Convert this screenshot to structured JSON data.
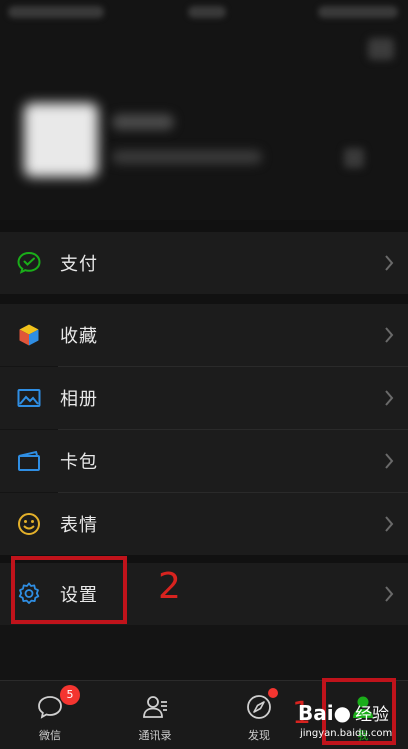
{
  "menu": {
    "pay": {
      "label": "支付",
      "icon": "wechat-pay-icon"
    },
    "favorites": {
      "label": "收藏",
      "icon": "favorites-cube-icon"
    },
    "album": {
      "label": "相册",
      "icon": "album-icon"
    },
    "cards": {
      "label": "卡包",
      "icon": "card-wallet-icon"
    },
    "stickers": {
      "label": "表情",
      "icon": "sticker-smiley-icon"
    },
    "settings": {
      "label": "设置",
      "icon": "gear-icon"
    }
  },
  "tabbar": {
    "chats": {
      "label": "微信",
      "badge": "5",
      "icon": "chat-bubble-icon"
    },
    "contacts": {
      "label": "通讯录",
      "icon": "contacts-icon"
    },
    "discover": {
      "label": "发现",
      "icon": "compass-icon"
    },
    "me": {
      "label": "我",
      "icon": "person-icon"
    }
  },
  "annotations": {
    "step1": "1",
    "step2": "2",
    "color": "#c0131b"
  },
  "watermark": {
    "logo": "Bai",
    "logo_suffix": "经验",
    "url": "jingyan.baidu.com"
  },
  "colors": {
    "background": "#141414",
    "row": "#1c1c1c",
    "pay_green": "#1aad19",
    "blue_icon": "#2f8ee3",
    "yellow_icon": "#e3b02a",
    "badge_red": "#f43530"
  }
}
